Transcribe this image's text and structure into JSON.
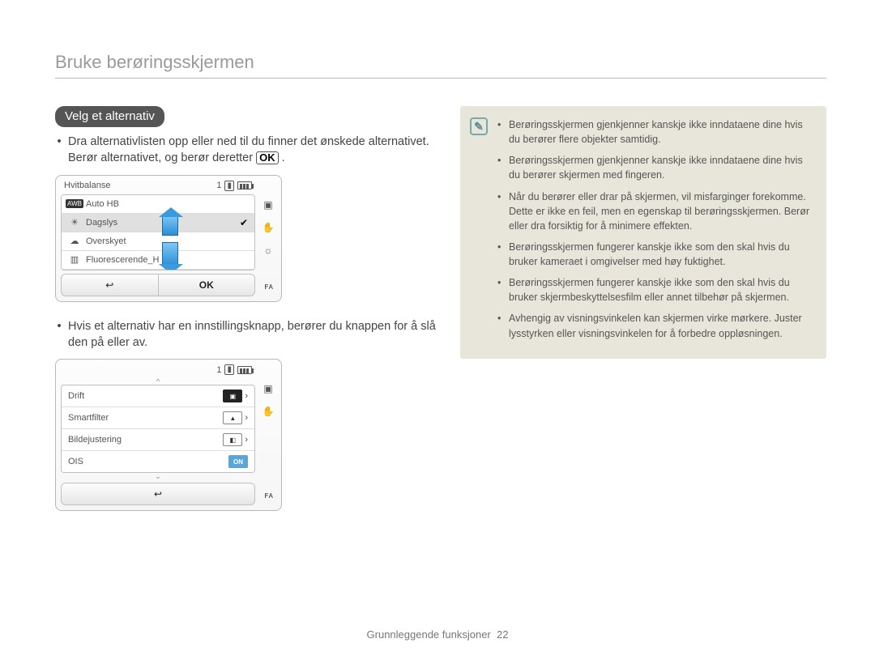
{
  "page_title": "Bruke berøringsskjermen",
  "section_heading": "Velg et alternativ",
  "intro_bullet_prefix": "Dra alternativlisten opp eller ned til du finner det ønskede alternativet. Berør alternativet, og berør deretter ",
  "intro_bullet_suffix": ".",
  "ok_label": "OK",
  "cam1": {
    "title": "Hvitbalanse",
    "count": "1",
    "rows": {
      "r0": "Auto HB",
      "r1": "Dagslys",
      "r2": "Overskyet",
      "r3": "Fluorescerende_H"
    },
    "ok": "OK"
  },
  "mid_bullet": "Hvis et alternativ har en innstillingsknapp, berører du knappen for å slå den på eller av.",
  "cam2": {
    "count": "1",
    "rows": {
      "r0": "Drift",
      "r1": "Smartfilter",
      "r2": "Bildejustering",
      "r3": "OIS"
    },
    "on": "ON"
  },
  "note_items": {
    "n0": "Berøringsskjermen gjenkjenner kanskje ikke inndataene dine hvis du berører flere objekter samtidig.",
    "n1": "Berøringsskjermen gjenkjenner kanskje ikke inndataene dine hvis du berører skjermen med fingeren.",
    "n2": "Når du berører eller drar på skjermen, vil misfarginger forekomme. Dette er ikke en feil, men en egenskap til berøringsskjermen. Berør eller dra forsiktig for å minimere effekten.",
    "n3": "Berøringsskjermen fungerer kanskje ikke som den skal hvis du bruker kameraet i omgivelser med høy fuktighet.",
    "n4": "Berøringsskjermen fungerer kanskje ikke som den skal hvis du bruker skjermbeskyttelsesfilm eller annet tilbehør på skjermen.",
    "n5": "Avhengig av visningsvinkelen kan skjermen virke mørkere. Juster lysstyrken eller visningsvinkelen for å forbedre oppløsningen."
  },
  "footer_label": "Grunnleggende funksjoner",
  "footer_page": "22",
  "flash_label": "ꜰᴀ"
}
